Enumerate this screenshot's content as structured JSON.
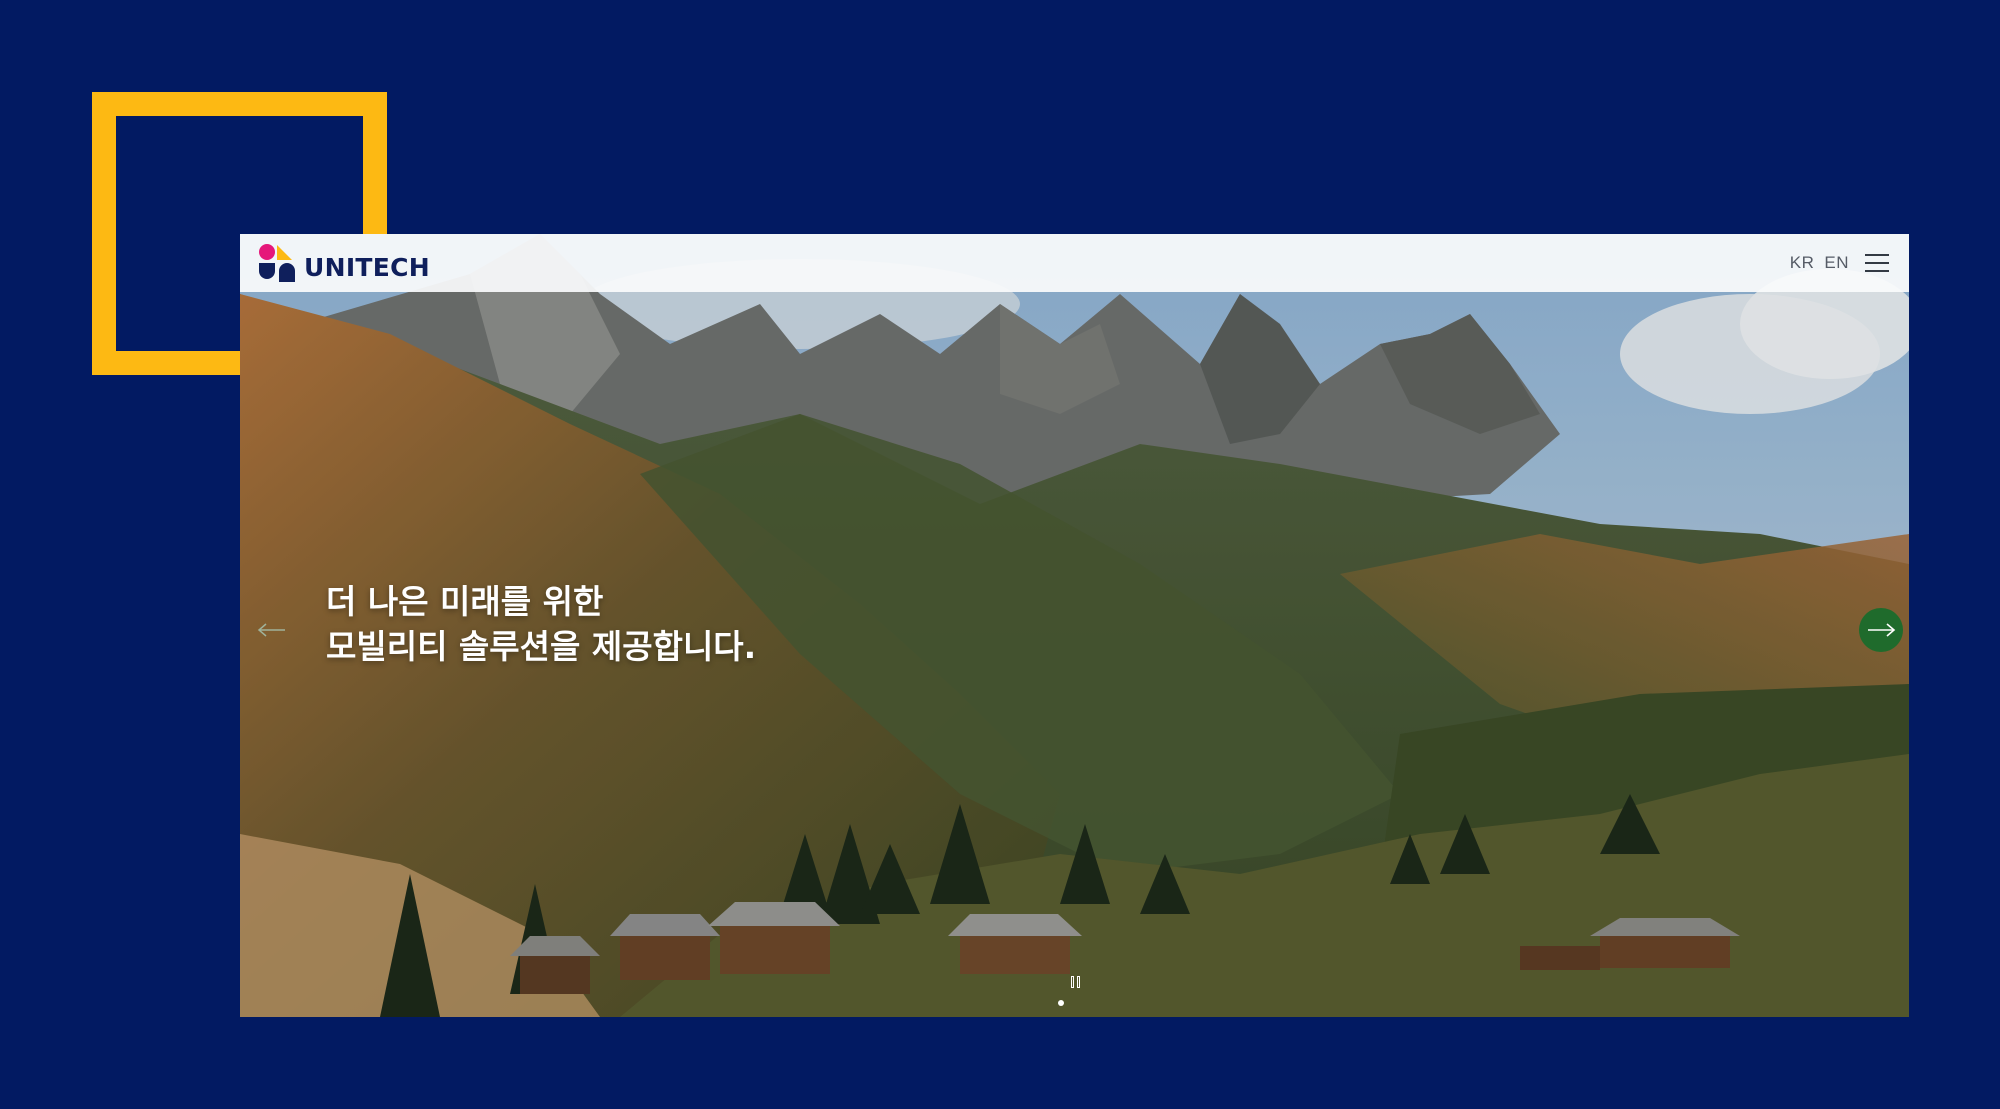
{
  "header": {
    "logo_text": "UNITECH",
    "lang_kr": "KR",
    "lang_en": "EN",
    "menu_icon": "hamburger-menu-icon"
  },
  "hero": {
    "headline_line1": "더 나은 미래를 위한",
    "headline_line2": "모빌리티 솔루션을 제공합니다.",
    "prev_icon": "arrow-left-icon",
    "next_icon": "arrow-right-icon",
    "pause_icon": "pause-icon",
    "slide_count": 1,
    "active_slide": 1
  },
  "colors": {
    "background": "#021a62",
    "accent_frame": "#fdb913",
    "logo_magenta": "#e5187a",
    "logo_yellow": "#fdb913",
    "logo_navy": "#0f1f5c",
    "next_button": "#1f6b2c"
  }
}
